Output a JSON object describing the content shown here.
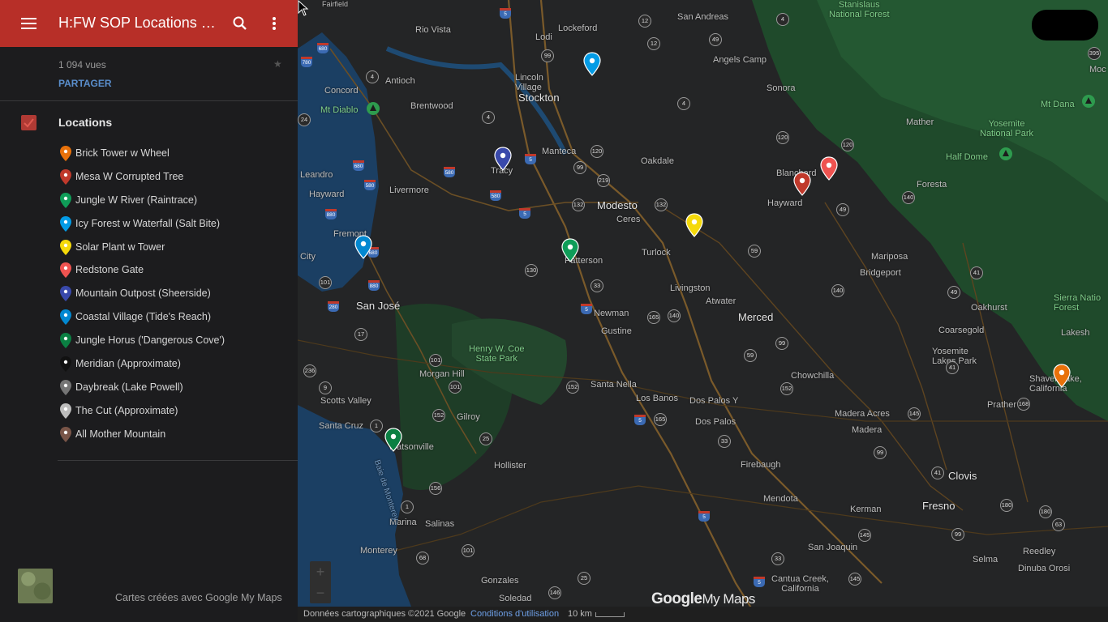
{
  "header": {
    "title": "H:FW SOP Locations M..."
  },
  "meta": {
    "views": "1 094 vues",
    "share_label": "PARTAGER"
  },
  "layer": {
    "name": "Locations"
  },
  "locations": [
    {
      "label": "Brick Tower w Wheel",
      "color": "#e8710a"
    },
    {
      "label": "Mesa W Corrupted Tree",
      "color": "#c0392b"
    },
    {
      "label": "Jungle W River (Raintrace)",
      "color": "#0f9d58"
    },
    {
      "label": "Icy Forest w Waterfall (Salt Bite)",
      "color": "#039be5"
    },
    {
      "label": "Solar Plant w Tower",
      "color": "#f5d90a"
    },
    {
      "label": "Redstone Gate",
      "color": "#ef5350"
    },
    {
      "label": "Mountain Outpost (Sheerside)",
      "color": "#3949ab"
    },
    {
      "label": "Coastal Village (Tide's Reach)",
      "color": "#0288d1"
    },
    {
      "label": "Jungle Horus ('Dangerous Cove')",
      "color": "#0b8043"
    },
    {
      "label": "Meridian (Approximate)",
      "color": "#111111"
    },
    {
      "label": "Daybreak (Lake Powell)",
      "color": "#757575"
    },
    {
      "label": "The Cut (Approximate)",
      "color": "#bdbdbd"
    },
    {
      "label": "All Mother Mountain",
      "color": "#795548"
    }
  ],
  "footer": {
    "credit": "Cartes créées avec Google My Maps"
  },
  "map": {
    "attribution": "Données cartographiques ©2021 Google",
    "terms": "Conditions d'utilisation",
    "scale": "10 km",
    "logo_google": "Google",
    "logo_mymaps": "My Maps",
    "zoom_in": "+",
    "zoom_out": "−",
    "places": {
      "stockton": "Stockton",
      "modesto": "Modesto",
      "sanjose": "San José",
      "fresno": "Fresno",
      "turlock": "Turlock",
      "merced": "Merced",
      "lodi": "Lodi",
      "tracy": "Tracy",
      "livermore": "Livermore",
      "hayward": "Hayward",
      "fremont": "Fremont",
      "concord": "Concord",
      "antioch": "Antioch",
      "brentwood": "Brentwood",
      "manteca": "Manteca",
      "oakdale": "Oakdale",
      "ceres": "Ceres",
      "patterson": "Patterson",
      "newman": "Newman",
      "gustine": "Gustine",
      "livingston": "Livingston",
      "atwater": "Atwater",
      "losbanos": "Los Banos",
      "santanella": "Santa Nella",
      "gilroy": "Gilroy",
      "morganhill": "Morgan Hill",
      "hollister": "Hollister",
      "salinas": "Salinas",
      "watsonville": "Watsonville",
      "santacruz": "Santa Cruz",
      "scottsvalley": "Scotts Valley",
      "marina": "Marina",
      "monterey": "Monterey",
      "gonzales": "Gonzales",
      "soledad": "Soledad",
      "madera": "Madera",
      "maderaacres": "Madera Acres",
      "clovis": "Clovis",
      "kerman": "Kerman",
      "firebaugh": "Firebaugh",
      "mendota": "Mendota",
      "sanjoaquin": "San Joaquin",
      "cantuacreek": "Cantua Creek,\nCalifornia",
      "chowchilla": "Chowchilla",
      "dospalosy": "Dos Palos Y",
      "dospalos": "Dos Palos",
      "mariposa": "Mariposa",
      "bridgeport": "Bridgeport",
      "coarsegold": "Coarsegold",
      "oakhurst": "Oakhurst",
      "yosemitelakes": "Yosemite\nLakes Park",
      "prather": "Prather",
      "shaverlake": "Shaver Lake,\nCalifornia",
      "foresta": "Foresta",
      "mather": "Mather",
      "sonora": "Sonora",
      "angelscamp": "Angels Camp",
      "sanandreas": "San Andreas",
      "lockeford": "Lockeford",
      "riovista": "Rio Vista",
      "lincolnvillage": "Lincoln\nVillage",
      "leandro": "Leandro",
      "cityedge": "City",
      "blanchard": "Blanchard",
      "haywardmtn": "Hayward",
      "reedley": "Reedley",
      "selma": "Selma",
      "dinuba": "Dinuba Orosi",
      "yosemitenp": "Yosemite\nNational Park",
      "halfdome": "Half Dome",
      "mtdana": "Mt Dana",
      "mtdiablo": "Mt Diablo",
      "sierra": "Sierra Natio\nForest",
      "stanislaus": "Stanislaus\nNational Forest",
      "henrycoe": "Henry W. Coe\nState Park",
      "baiemonterey": "Baie de Monterey",
      "lakes": "Lakesh",
      "moc": "Moc",
      "fairfield": "Fairfield"
    }
  }
}
